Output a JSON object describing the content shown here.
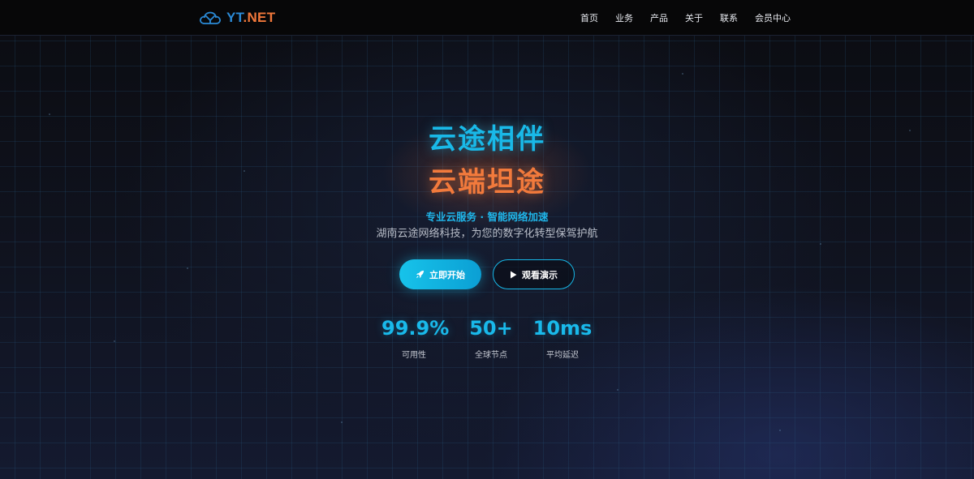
{
  "brand": {
    "logo_icon": "cloud-logo-icon",
    "name_part1": "YT",
    "name_part2": ".NET",
    "colors": {
      "primary": "#2b8ad6",
      "accent": "#f0773a"
    }
  },
  "nav": {
    "items": [
      {
        "label": "首页"
      },
      {
        "label": "业务"
      },
      {
        "label": "产品"
      },
      {
        "label": "关于"
      },
      {
        "label": "联系"
      },
      {
        "label": "会员中心"
      }
    ]
  },
  "hero": {
    "title_line1": "云途相伴",
    "title_line2": "云端坦途",
    "subtitle": "专业云服务 · 智能网络加速",
    "description": "湖南云途网络科技，为您的数字化转型保驾护航",
    "primary_button": {
      "label": "立即开始",
      "icon": "rocket-icon"
    },
    "secondary_button": {
      "label": "观看演示",
      "icon": "play-icon"
    },
    "colors": {
      "cyan": "#19b9e8",
      "orange": "#f27a3c"
    }
  },
  "stats": [
    {
      "value": "99.9%",
      "label": "可用性"
    },
    {
      "value": "50+",
      "label": "全球节点"
    },
    {
      "value": "10ms",
      "label": "平均延迟"
    }
  ]
}
